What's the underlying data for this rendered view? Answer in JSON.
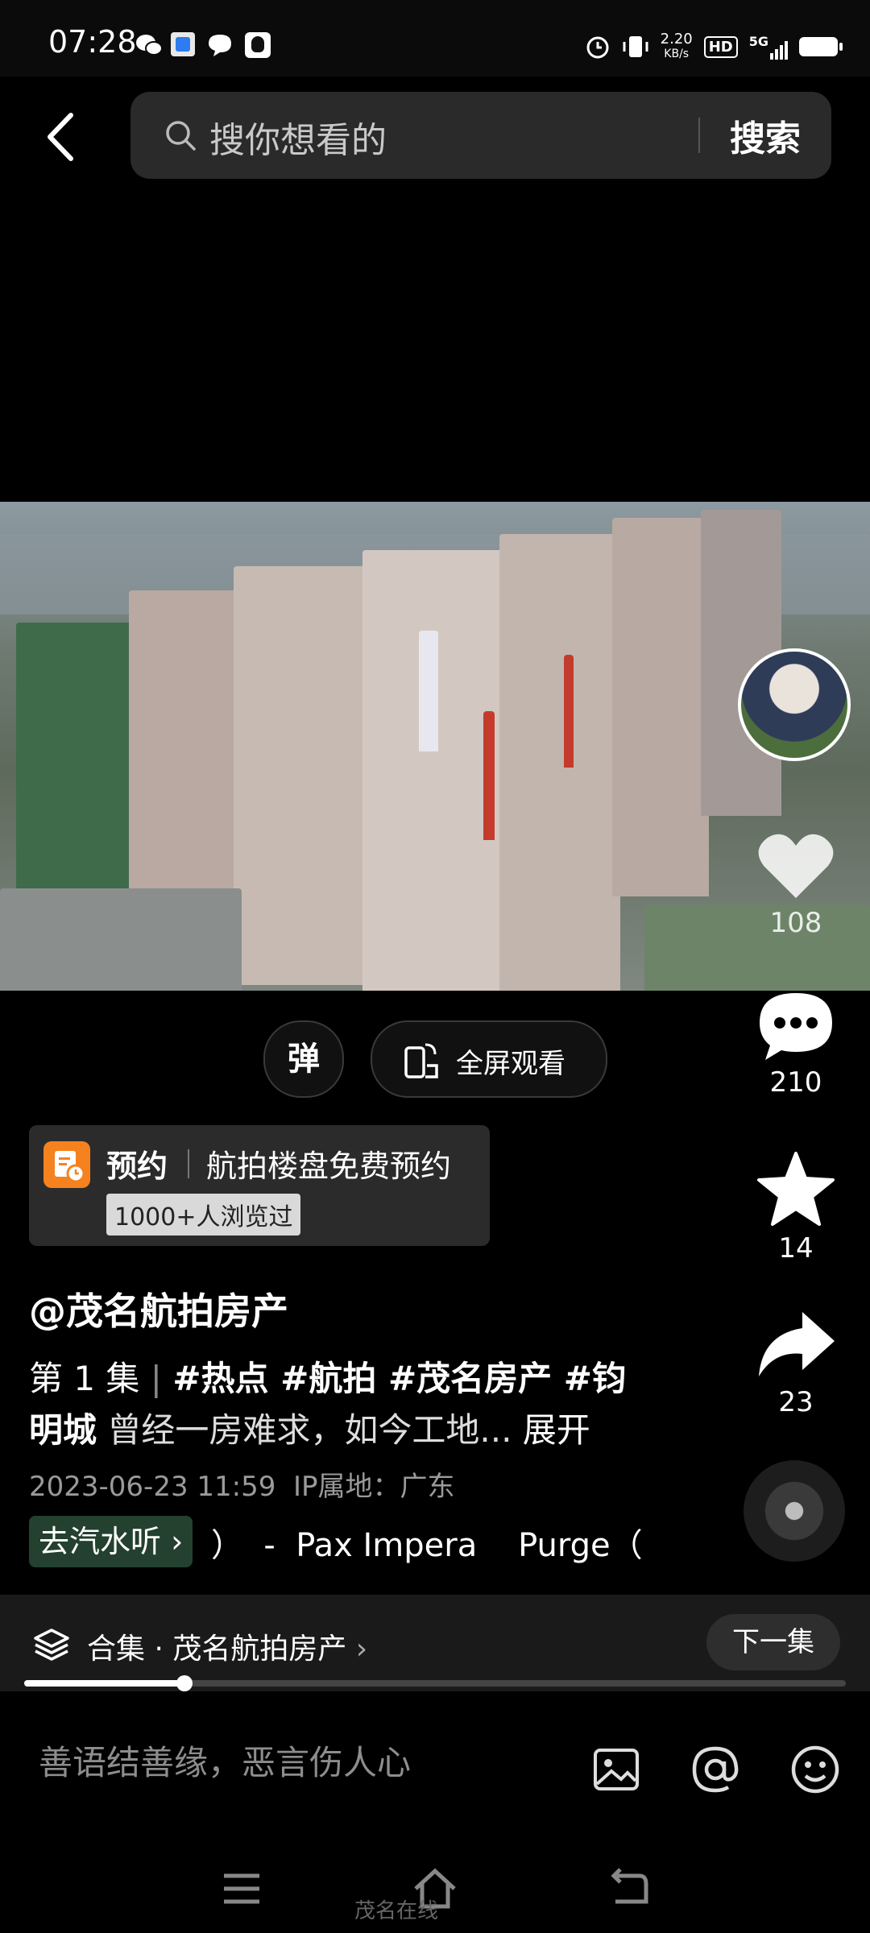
{
  "status_bar": {
    "time": "07:28",
    "net_speed_top": "2.20",
    "net_speed_bottom": "KB/s",
    "hd": "HD",
    "network": "5G"
  },
  "header": {
    "back_icon": "chevron-left-icon",
    "search_placeholder": "搜你想看的",
    "search_button": "搜索"
  },
  "video_controls": {
    "danmu_label": "弹",
    "fullscreen_label": "全屏观看"
  },
  "side_actions": {
    "like_count": "108",
    "comment_count": "210",
    "favorite_count": "14",
    "share_count": "23"
  },
  "booking": {
    "title": "预约",
    "description": "航拍楼盘免费预约",
    "views": "1000+人浏览过"
  },
  "post": {
    "author": "@茂名航拍房产",
    "episode": "第 1 集",
    "episode_sep": "|",
    "tags_line1": "#热点 #航拍 #茂名房产 #钧",
    "tags_line2": "明城",
    "text": "曾经一房难求，如今工地...",
    "expand": "展开",
    "date": "2023-06-23 11:59",
    "ip": "IP属地：广东",
    "music_chip": "去汽水听",
    "music_text": "）  -  Pax Impera    Purge（"
  },
  "collection": {
    "label": "合集 · 茂名航拍房产",
    "next_button": "下一集",
    "progress": 0.195
  },
  "comment": {
    "placeholder": "善语结善缘，恶言伤人心"
  },
  "watermark": "茂名在线"
}
